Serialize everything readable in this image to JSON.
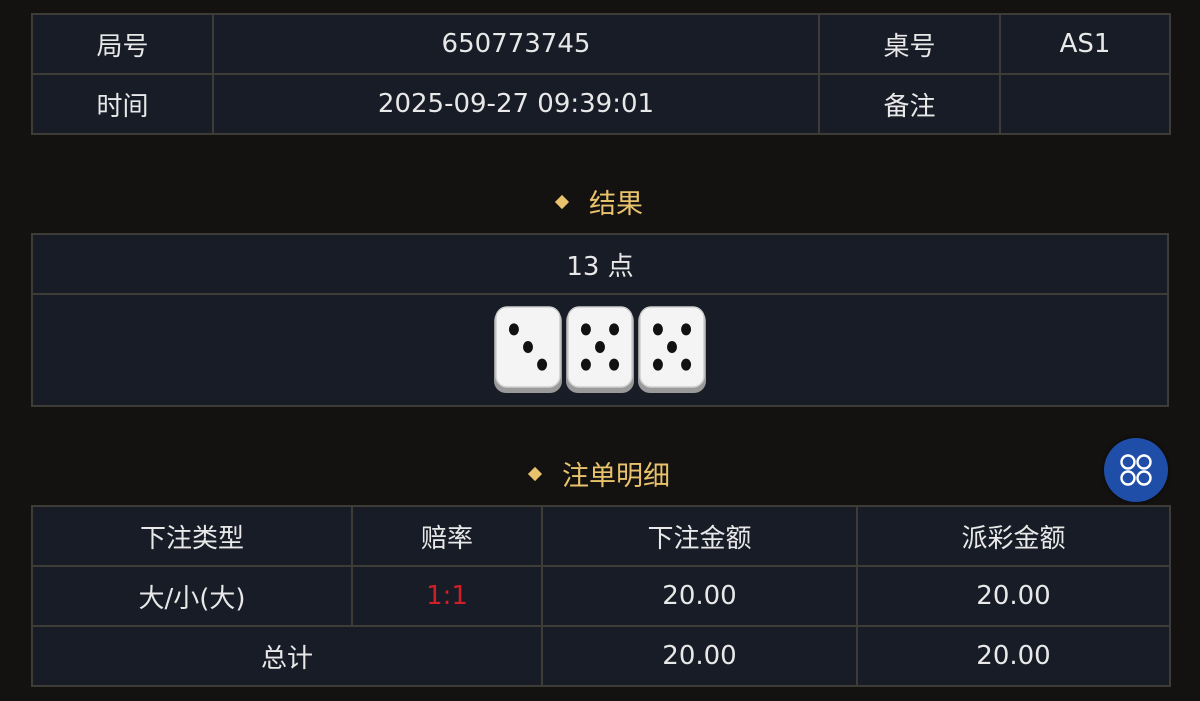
{
  "info": {
    "round_label": "局号",
    "round_value": "650773745",
    "table_label": "桌号",
    "table_value": "AS1",
    "time_label": "时间",
    "time_value": "2025-09-27 09:39:01",
    "note_label": "备注",
    "note_value": ""
  },
  "result": {
    "title": "结果",
    "points_text": "13 点",
    "dice": [
      3,
      5,
      5
    ]
  },
  "detail": {
    "title": "注单明细",
    "headers": [
      "下注类型",
      "赔率",
      "下注金额",
      "派彩金额"
    ],
    "rows": [
      {
        "type": "大/小(大)",
        "odds": "1:1",
        "bet": "20.00",
        "payout": "20.00"
      }
    ],
    "total": {
      "label": "总计",
      "bet": "20.00",
      "payout": "20.00"
    }
  },
  "colors": {
    "accent": "#e8c26c",
    "odds": "#d21f27",
    "float_button": "#1f4ea8"
  },
  "float_button_icon": "grid-menu-icon"
}
